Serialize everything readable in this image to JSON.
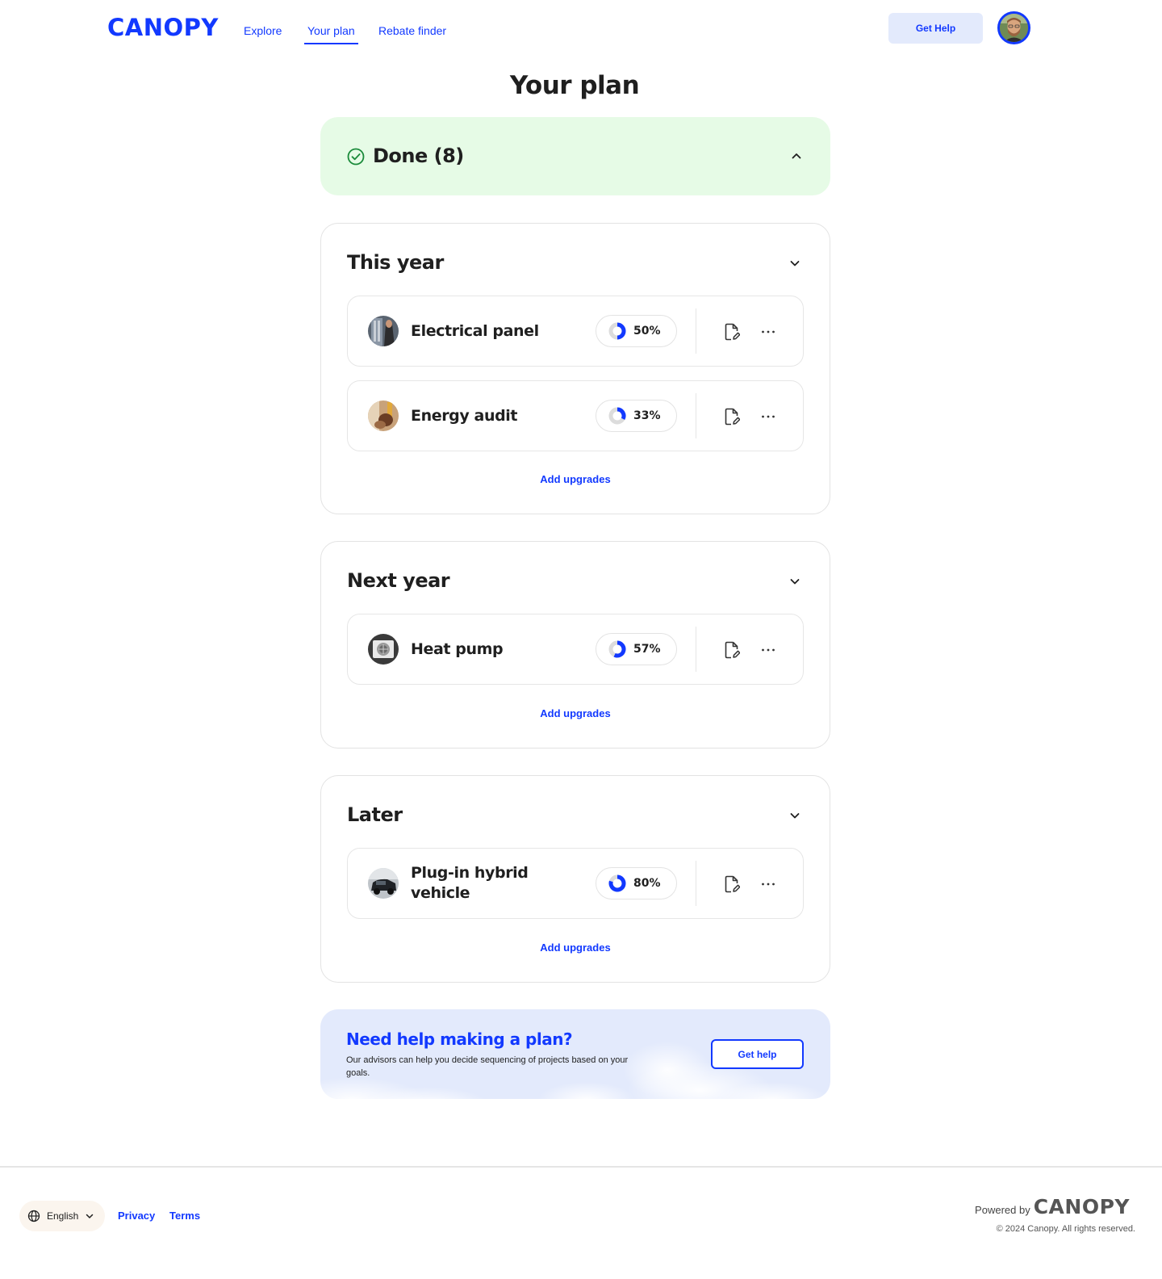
{
  "header": {
    "logo": "CANOPY",
    "nav": [
      {
        "label": "Explore",
        "active": false
      },
      {
        "label": "Your plan",
        "active": true
      },
      {
        "label": "Rebate finder",
        "active": false
      }
    ],
    "get_help_label": "Get Help"
  },
  "page_title": "Your plan",
  "done": {
    "title": "Done (8)"
  },
  "sections": [
    {
      "title": "This year",
      "items": [
        {
          "name": "Electrical panel",
          "progress_label": "50%",
          "progress": 0.5
        },
        {
          "name": "Energy audit",
          "progress_label": "33%",
          "progress": 0.33
        }
      ],
      "add_label": "Add upgrades"
    },
    {
      "title": "Next year",
      "items": [
        {
          "name": "Heat pump",
          "progress_label": "57%",
          "progress": 0.57
        }
      ],
      "add_label": "Add upgrades"
    },
    {
      "title": "Later",
      "items": [
        {
          "name": "Plug-in hybrid vehicle",
          "name_line1": "Plug-in hybrid",
          "name_line2": "vehicle",
          "progress_label": "80%",
          "progress": 0.8
        }
      ],
      "add_label": "Add upgrades"
    }
  ],
  "help_banner": {
    "title": "Need help making a plan?",
    "text": "Our advisors can help you decide sequencing of projects based on your goals.",
    "button_label": "Get help"
  },
  "footer": {
    "language": "English",
    "links": [
      "Privacy",
      "Terms"
    ],
    "powered_by": "Powered by",
    "powered_logo": "CANOPY",
    "copyright": "© 2024 Canopy. All rights reserved."
  },
  "colors": {
    "brand_blue": "#1239ff",
    "done_bg": "#e6fbe6",
    "done_check": "#1a8a3a",
    "help_bg": "#e3eafc",
    "progress_track": "#dcdcdc"
  },
  "icons": [
    "check-circle-icon",
    "chevron-up-icon",
    "chevron-down-icon",
    "document-edit-icon",
    "more-horizontal-icon",
    "globe-icon",
    "progress-ring-icon"
  ]
}
